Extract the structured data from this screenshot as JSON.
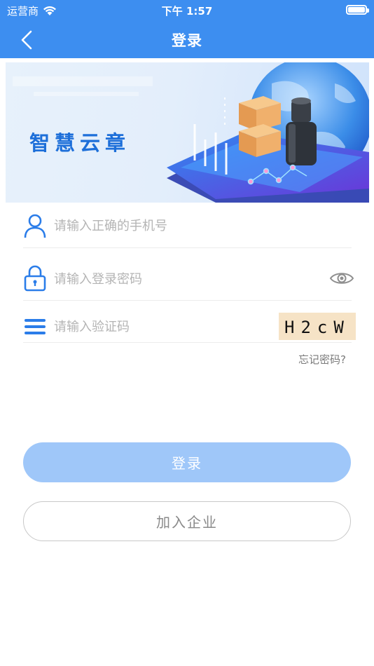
{
  "status_bar": {
    "carrier": "运营商",
    "time": "下午 1:57"
  },
  "nav": {
    "title": "登录"
  },
  "banner": {
    "text": "智慧云章"
  },
  "form": {
    "phone_placeholder": "请输入正确的手机号",
    "password_placeholder": "请输入登录密码",
    "captcha_placeholder": "请输入验证码",
    "captcha_text": "H2cW",
    "forgot_label": "忘记密码?"
  },
  "buttons": {
    "login_label": "登录",
    "join_label": "加入企业"
  },
  "colors": {
    "primary": "#3d8ef0",
    "login_button": "#9fc7f9",
    "captcha_bg": "#f6e3c6"
  },
  "icons": {
    "back": "chevron-left-icon",
    "user": "user-icon",
    "lock": "lock-icon",
    "eye": "eye-icon",
    "captcha": "menu-icon"
  }
}
